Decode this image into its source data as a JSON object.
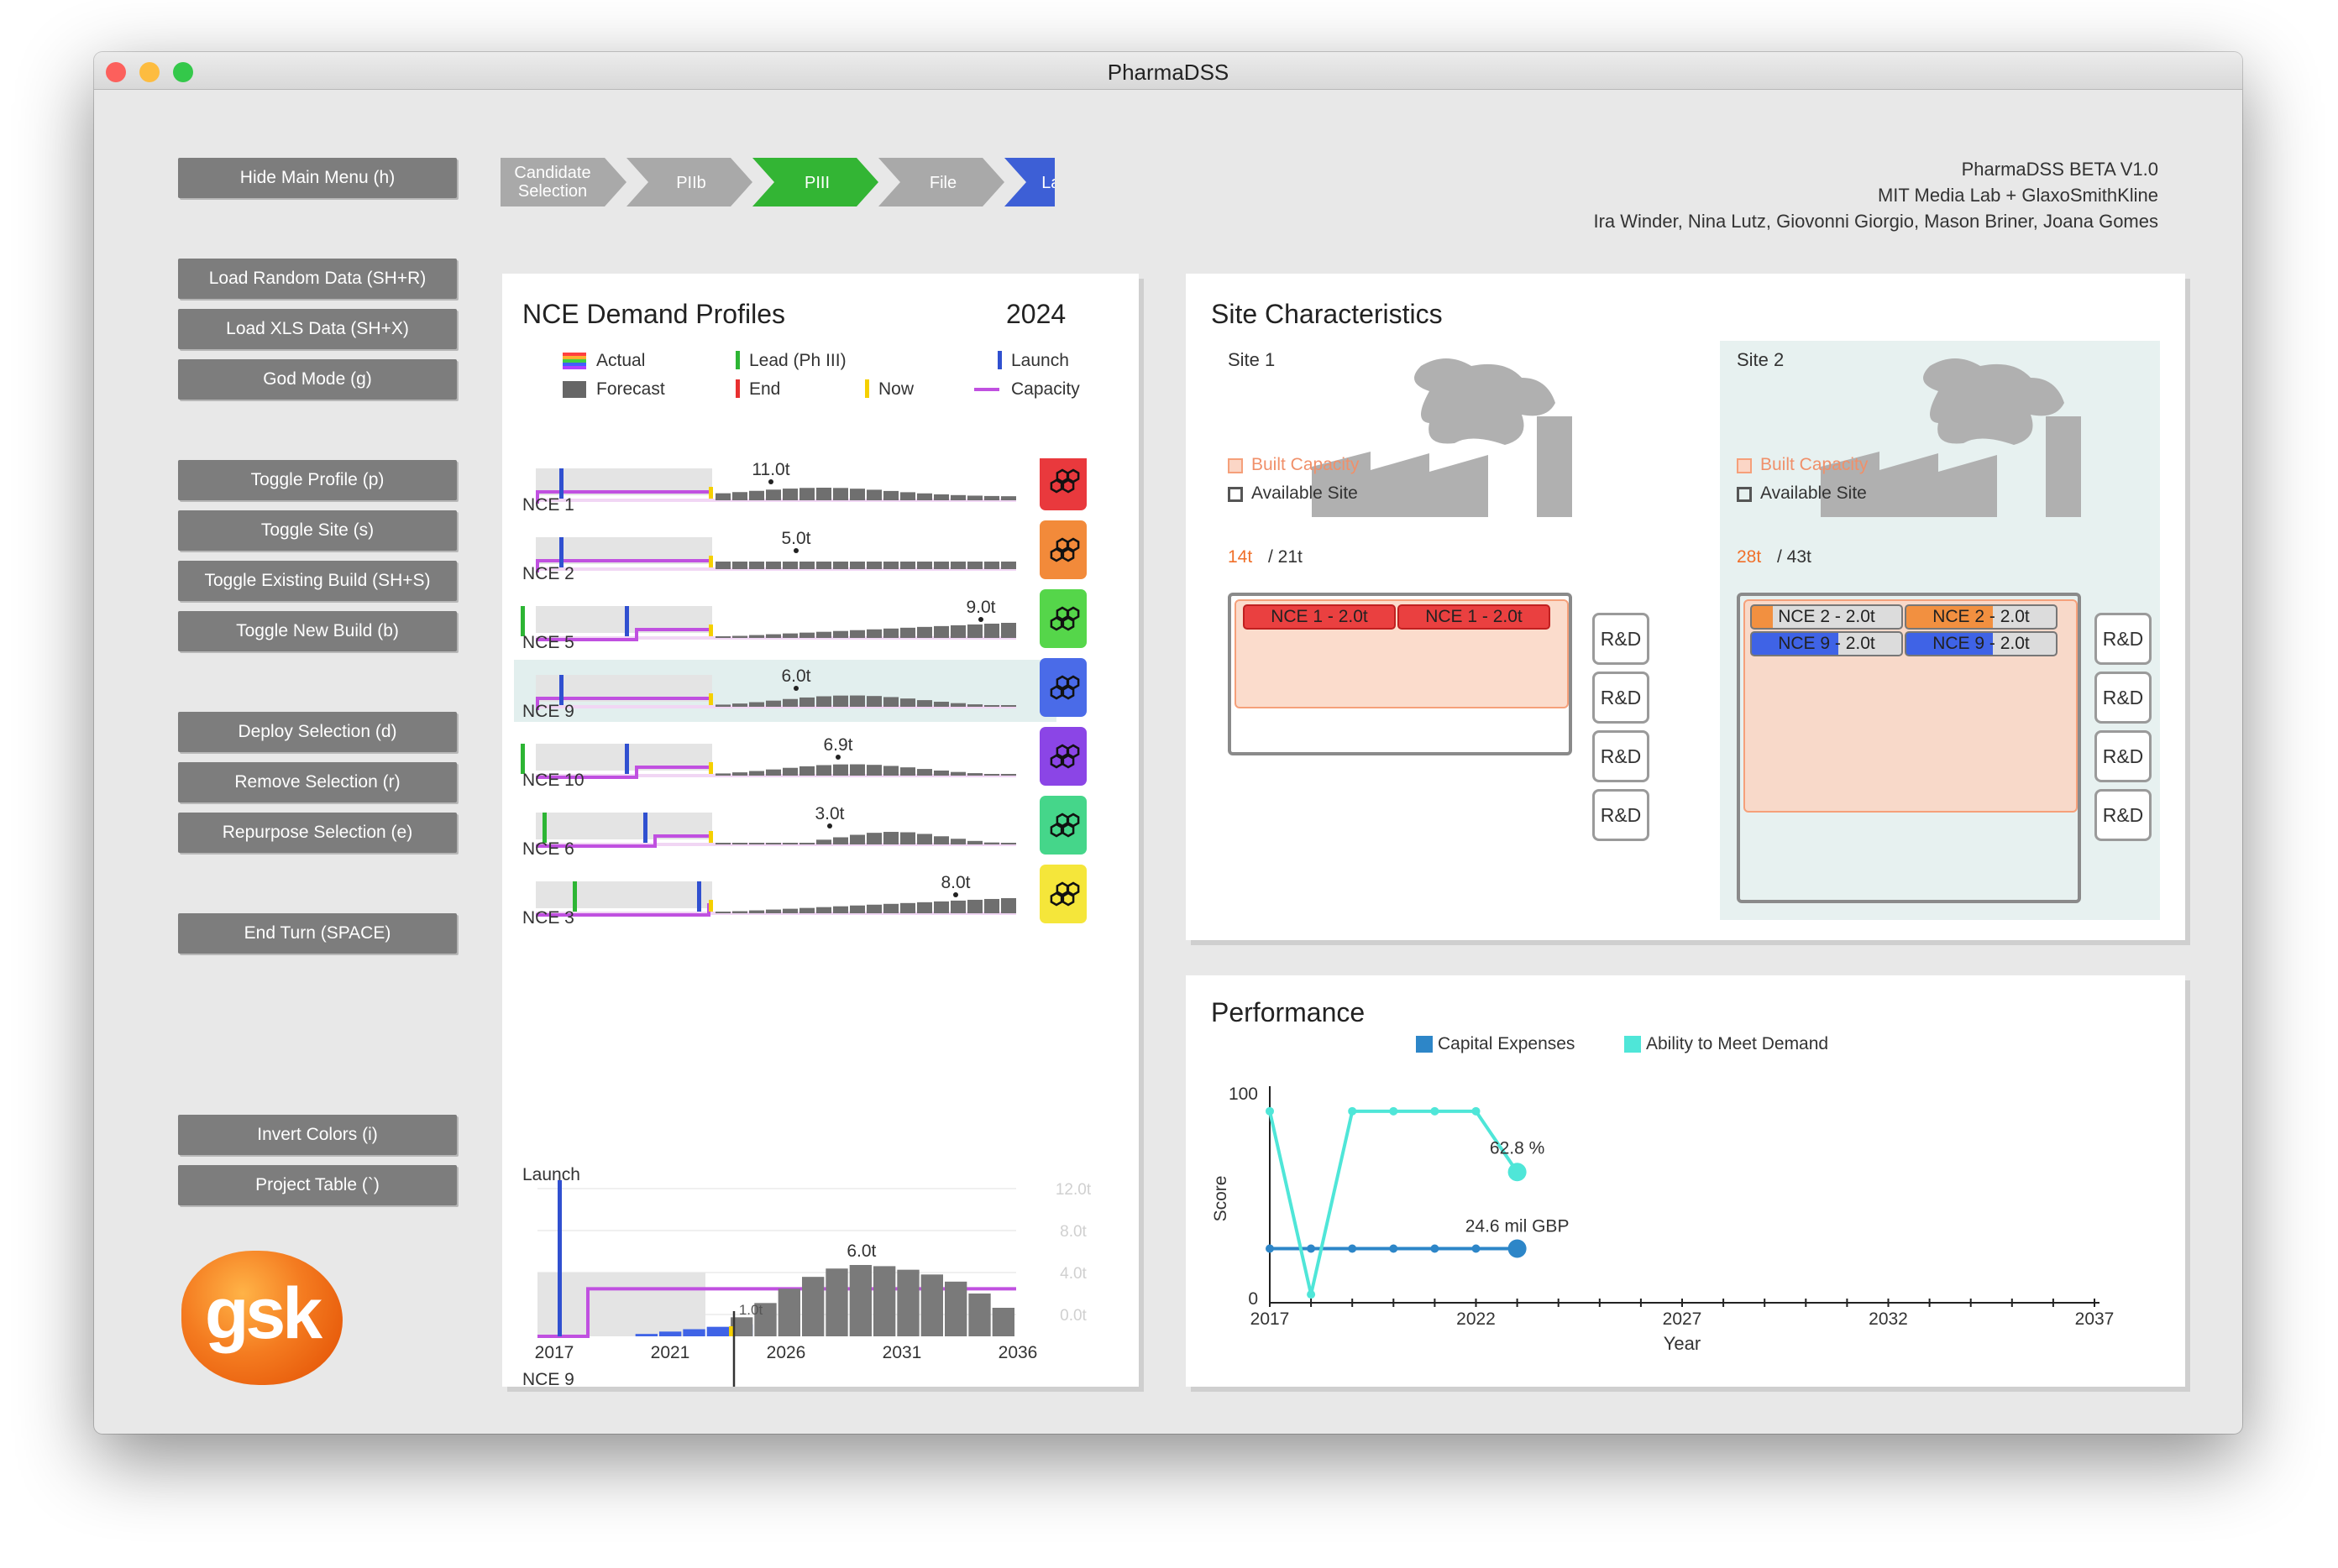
{
  "window": {
    "title": "PharmaDSS"
  },
  "menu": {
    "hide_main_menu": "Hide Main Menu (h)",
    "load_random": "Load Random Data (SH+R)",
    "load_xls": "Load XLS Data (SH+X)",
    "god_mode": "God Mode (g)",
    "toggle_profile": "Toggle Profile (p)",
    "toggle_site": "Toggle Site (s)",
    "toggle_existing_build": "Toggle Existing Build (SH+S)",
    "toggle_new_build": "Toggle New Build (b)",
    "deploy_selection": "Deploy Selection (d)",
    "remove_selection": "Remove Selection (r)",
    "repurpose_selection": "Repurpose Selection (e)",
    "end_turn": "End Turn (SPACE)",
    "invert_colors": "Invert Colors (i)",
    "project_table": "Project Table (`)"
  },
  "logo": {
    "text": "gsk"
  },
  "phases": [
    {
      "label": "Candidate Selection",
      "color": "#a9a9a9"
    },
    {
      "label": "PIIb",
      "color": "#a9a9a9"
    },
    {
      "label": "PIII",
      "color": "#33b534"
    },
    {
      "label": "File",
      "color": "#a9a9a9"
    },
    {
      "label": "Launch",
      "color": "#3d5fd6"
    }
  ],
  "credits": {
    "line1": "PharmaDSS BETA V1.0",
    "line2": "MIT Media Lab + GlaxoSmithKline",
    "line3": "Ira Winder, Nina Lutz, Giovonni Giorgio, Mason Briner, Joana Gomes"
  },
  "demand": {
    "title": "NCE Demand Profiles",
    "year": "2024",
    "legend": {
      "actual": "Actual",
      "forecast": "Forecast",
      "lead": "Lead (Ph III)",
      "end": "End",
      "launch": "Launch",
      "now": "Now",
      "capacity": "Capacity"
    },
    "profiles": [
      {
        "name": "NCE 1",
        "peak_label": "11.0t",
        "color": "#e9393d",
        "selected": false
      },
      {
        "name": "NCE 2",
        "peak_label": "5.0t",
        "color": "#f28a3a",
        "selected": false
      },
      {
        "name": "NCE 5",
        "peak_label": "9.0t",
        "color": "#55d64a",
        "selected": false
      },
      {
        "name": "NCE 9",
        "peak_label": "6.0t",
        "color": "#4a6be8",
        "selected": true
      },
      {
        "name": "NCE 10",
        "peak_label": "6.9t",
        "color": "#8b45e6",
        "selected": false
      },
      {
        "name": "NCE 6",
        "peak_label": "3.0t",
        "color": "#45d68a",
        "selected": false
      },
      {
        "name": "NCE 3",
        "peak_label": "8.0t",
        "color": "#f5e63a",
        "selected": false
      }
    ],
    "detail": {
      "title": "Launch",
      "nce": "NCE 9",
      "peak_label": "6.0t",
      "small_label": "1.0t",
      "now_label": "2024",
      "x_ticks": [
        "2017",
        "2021",
        "2026",
        "2031",
        "2036"
      ],
      "y_ticks": [
        "12.0t",
        "8.0t",
        "4.0t",
        "0.0t"
      ]
    }
  },
  "sites": {
    "title": "Site Characteristics",
    "legend_built": "Built Capacity",
    "legend_available": "Available Site",
    "rd_label": "R&D",
    "site1": {
      "name": "Site 1",
      "built": "14t",
      "total": "/ 21t",
      "modules": [
        "NCE 1 - 2.0t",
        "NCE 1 - 2.0t"
      ]
    },
    "site2": {
      "name": "Site 2",
      "built": "28t",
      "total": "/ 43t",
      "modules": [
        "NCE 2 - 2.0t",
        "NCE 2 - 2.0t",
        "NCE 9 - 2.0t",
        "NCE 9 - 2.0t"
      ]
    }
  },
  "performance": {
    "title": "Performance",
    "legend": [
      {
        "label": "Capital Expenses",
        "color": "#2d86c8"
      },
      {
        "label": "Ability to Meet Demand",
        "color": "#4fe6d8"
      }
    ],
    "ylabel": "Score",
    "xlabel": "Year",
    "y_ticks": [
      "100",
      "0"
    ],
    "x_ticks": [
      "2017",
      "2022",
      "2027",
      "2032",
      "2037"
    ],
    "demand_end_label": "62.8 %",
    "capex_end_label": "24.6 mil GBP"
  },
  "chart_data": [
    {
      "type": "line",
      "title": "Performance",
      "xlabel": "Year",
      "ylabel": "Score",
      "xlim": [
        2017,
        2037
      ],
      "ylim": [
        0,
        100
      ],
      "x": [
        2017,
        2018,
        2019,
        2020,
        2021,
        2022,
        2023
      ],
      "series": [
        {
          "name": "Capital Expenses",
          "values": [
            26,
            26,
            26,
            26,
            26,
            26,
            26
          ]
        },
        {
          "name": "Ability to Meet Demand",
          "values": [
            92,
            4,
            92,
            92,
            92,
            92,
            62.8
          ]
        }
      ]
    },
    {
      "type": "bar",
      "title": "Launch",
      "xlabel": "NCE 9",
      "x": [
        2018,
        2019,
        2020,
        2021,
        2022,
        2023,
        2024,
        2025,
        2026,
        2027,
        2028,
        2029,
        2030,
        2031,
        2032,
        2033,
        2034,
        2035
      ],
      "series": [
        {
          "name": "Actual",
          "values": [
            0,
            0,
            0.2,
            0.4,
            0.6,
            0.8,
            1.0,
            null,
            null,
            null,
            null,
            null,
            null,
            null,
            null,
            null,
            null,
            null
          ]
        },
        {
          "name": "Forecast",
          "values": [
            null,
            null,
            null,
            null,
            null,
            null,
            1.6,
            2.8,
            4.0,
            5.0,
            5.7,
            6.0,
            5.9,
            5.6,
            5.2,
            4.6,
            3.6,
            2.4
          ]
        },
        {
          "name": "Capacity",
          "values": [
            0,
            4,
            4,
            4,
            4,
            4,
            4,
            4,
            4,
            4,
            4,
            4,
            4,
            4,
            4,
            4,
            4,
            4
          ]
        }
      ],
      "ylim": [
        0,
        12
      ]
    }
  ]
}
